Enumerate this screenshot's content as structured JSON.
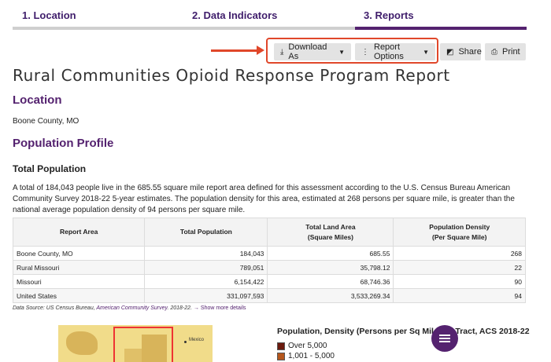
{
  "steps": [
    {
      "label": "1. Location"
    },
    {
      "label": "2. Data Indicators"
    },
    {
      "label": "3. Reports"
    }
  ],
  "toolbar": {
    "download_label": "Download As",
    "options_label": "Report Options",
    "share_label": "Share",
    "print_label": "Print"
  },
  "report": {
    "title": "Rural Communities Opioid Response Program Report",
    "location_heading": "Location",
    "location_value": "Boone County, MO",
    "section_heading": "Population Profile",
    "subsection_heading": "Total Population",
    "paragraph": "A total of 184,043 people live in the 685.55 square mile report area defined for this assessment according to the U.S. Census Bureau American Community Survey 2018-22 5-year estimates. The population density for this area, estimated at 268 persons per square mile, is greater than the national average population density of 94 persons per square mile."
  },
  "table": {
    "headers": [
      {
        "line1": "Report Area",
        "line2": ""
      },
      {
        "line1": "Total Population",
        "line2": ""
      },
      {
        "line1": "Total Land Area",
        "line2": "(Square Miles)"
      },
      {
        "line1": "Population Density",
        "line2": "(Per Square Mile)"
      }
    ],
    "rows": [
      [
        "Boone County, MO",
        "184,043",
        "685.55",
        "268"
      ],
      [
        "Rural Missouri",
        "789,051",
        "35,798.12",
        "22"
      ],
      [
        "Missouri",
        "6,154,422",
        "68,746.36",
        "90"
      ],
      [
        "United States",
        "331,097,593",
        "3,533,269.34",
        "94"
      ]
    ]
  },
  "source": {
    "prefix": "Data Source: US Census Bureau, ",
    "link": "American Community Survey",
    "suffix": ". 2018-22.",
    "more": "→ Show more details"
  },
  "map": {
    "label": "Mexico"
  },
  "legend": {
    "title": "Population, Density (Persons per Sq Mile) by Tract, ACS 2018-22",
    "items": [
      {
        "label": "Over 5,000",
        "color": "#6b1a0e"
      },
      {
        "label": "1,001 - 5,000",
        "color": "#b5561c"
      }
    ]
  },
  "colors": {
    "brand_purple": "#54226f",
    "callout_red": "#e0472a"
  },
  "icons": {
    "download": "download-icon",
    "options": "kebab-icon",
    "share": "share-icon",
    "print": "print-icon",
    "menu": "hamburger-menu-icon"
  }
}
